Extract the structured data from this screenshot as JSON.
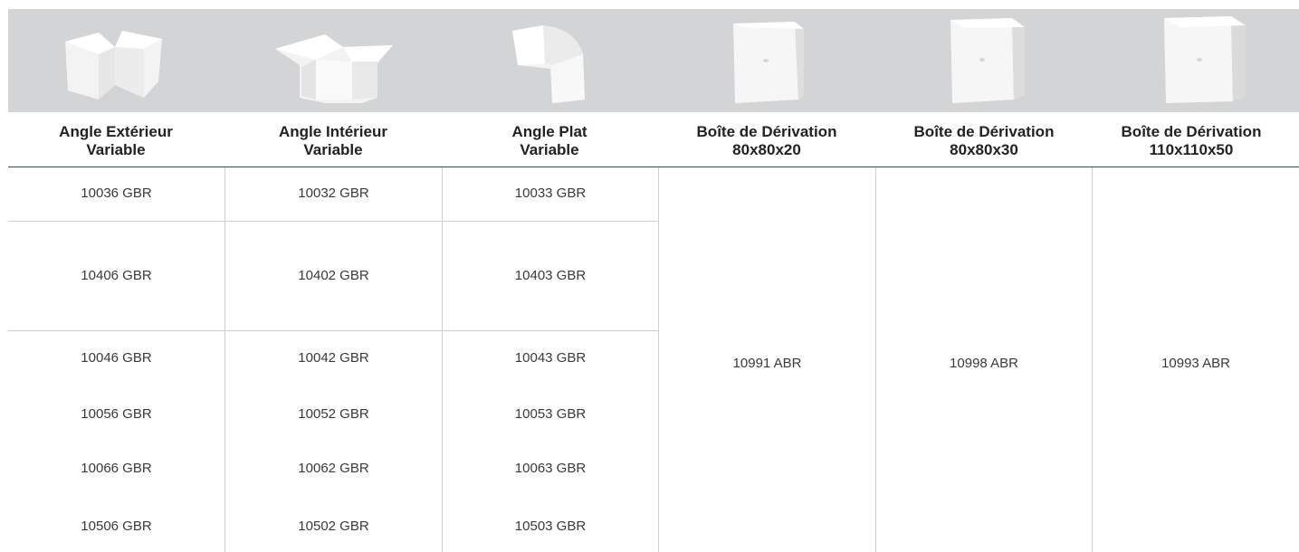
{
  "columns": [
    {
      "title1": "Angle Extérieur",
      "title2": "Variable",
      "icon": "external-angle-icon"
    },
    {
      "title1": "Angle Intérieur",
      "title2": "Variable",
      "icon": "internal-angle-icon"
    },
    {
      "title1": "Angle Plat",
      "title2": "Variable",
      "icon": "flat-angle-icon"
    },
    {
      "title1": "Boîte de Dérivation",
      "title2": "80x80x20",
      "icon": "junction-box-icon"
    },
    {
      "title1": "Boîte de Dérivation",
      "title2": "80x80x30",
      "icon": "junction-box-icon"
    },
    {
      "title1": "Boîte de Dérivation",
      "title2": "110x110x50",
      "icon": "junction-box-icon"
    }
  ],
  "rows": [
    [
      "10036 GBR",
      "10032 GBR",
      "10033 GBR"
    ],
    [
      "10406 GBR",
      "10402 GBR",
      "10403 GBR"
    ],
    [
      "10046 GBR",
      "10042 GBR",
      "10043 GBR"
    ],
    [
      "10056 GBR",
      "10052 GBR",
      "10053 GBR"
    ],
    [
      "10066 GBR",
      "10062 GBR",
      "10063 GBR"
    ],
    [
      "10506 GBR",
      "10502 GBR",
      "10503 GBR"
    ]
  ],
  "boxes": [
    "10991 ABR",
    "10998 ABR",
    "10993 ABR"
  ]
}
